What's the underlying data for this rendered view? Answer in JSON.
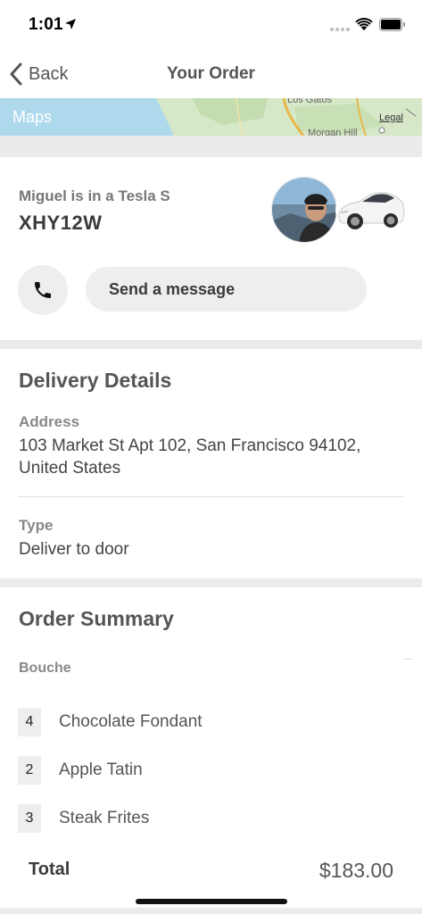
{
  "status_bar": {
    "time": "1:01"
  },
  "nav": {
    "back_label": "Back",
    "title": "Your Order"
  },
  "map": {
    "logo_text": "Maps",
    "legal": "Legal",
    "city_top": "Los Gatos",
    "city_bottom": "Morgan Hill"
  },
  "driver": {
    "line": "Miguel is in a Tesla S",
    "plate": "XHY12W",
    "message_button": "Send a message"
  },
  "delivery": {
    "title": "Delivery Details",
    "address_label": "Address",
    "address_value": "103 Market St Apt 102, San Francisco 94102, United States",
    "type_label": "Type",
    "type_value": "Deliver to door"
  },
  "summary": {
    "title": "Order Summary",
    "restaurant": "Bouche",
    "items": [
      {
        "qty": "4",
        "name": "Chocolate Fondant"
      },
      {
        "qty": "2",
        "name": "Apple Tatin"
      },
      {
        "qty": "3",
        "name": "Steak Frites"
      }
    ],
    "total_label": "Total",
    "total_value": "$183.00"
  },
  "colors": {
    "accent_gray": "#eeeeee",
    "section_gap": "#ebebeb",
    "map_water": "#aed9ec"
  }
}
